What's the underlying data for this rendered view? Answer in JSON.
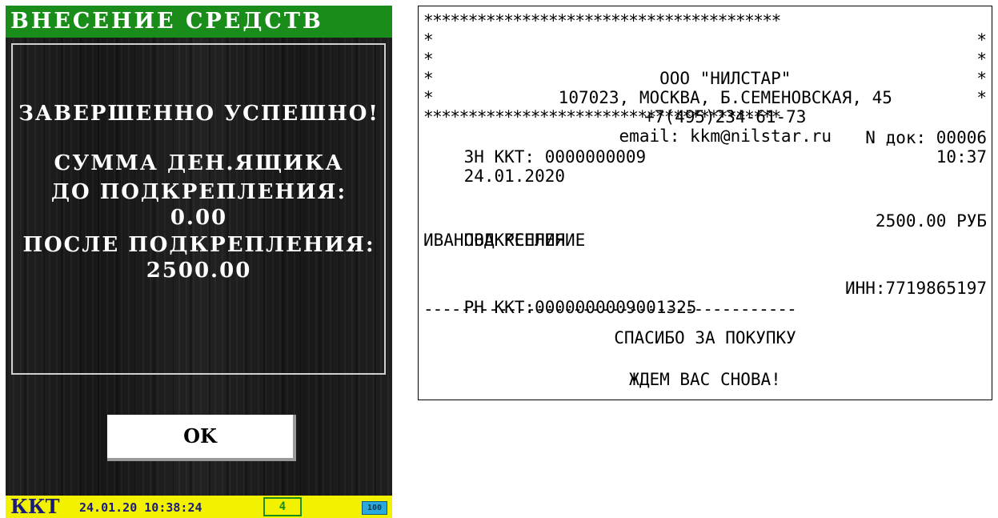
{
  "device": {
    "title": "ВНЕСЕНИЕ СРЕДСТВ",
    "message_lines": [
      "ЗАВЕРШЕННО УСПЕШНО!",
      "СУММА ДЕН.ЯЩИКА",
      "ДО ПОДКРЕПЛЕНИЯ:",
      "0.00",
      "ПОСЛЕ ПОДКРЕПЛЕНИЯ:",
      "2500.00"
    ],
    "ok_label": "OK",
    "status": {
      "kkt_label": "ККТ",
      "datetime": "24.01.20 10:38:24",
      "count": "4",
      "battery": "100"
    },
    "colors": {
      "title_bg": "#1a8c1a",
      "status_bg": "#f2f200",
      "battery": "#2aa8e0"
    }
  },
  "receipt": {
    "stars_line": "****************************************",
    "star": "*",
    "company": "ООО \"НИЛСТАР\"",
    "address": "107023, МОСКВА, Б.СЕМЕНОВСКАЯ, 45",
    "phone": "+7(495)234-61-73",
    "email": "email: kkm@nilstar.ru",
    "zn_kkt": "ЗН ККТ: 0000000009",
    "doc_no": "N док: 00006",
    "date": "24.01.2020",
    "time": "10:37",
    "operation": "ПОДКРЕПЛЕНИЕ",
    "amount": "2500.00 РУБ",
    "cashier": "ИВАНОВА КСЕНИЯ",
    "rn_kkt": "РН ККТ:0000000009001325",
    "inn": "ИНН:7719865197",
    "dash_line": "----------------------------------------",
    "thanks": "СПАСИБО ЗА ПОКУПКУ",
    "goodbye": "ЖДЕМ ВАС СНОВА!"
  }
}
